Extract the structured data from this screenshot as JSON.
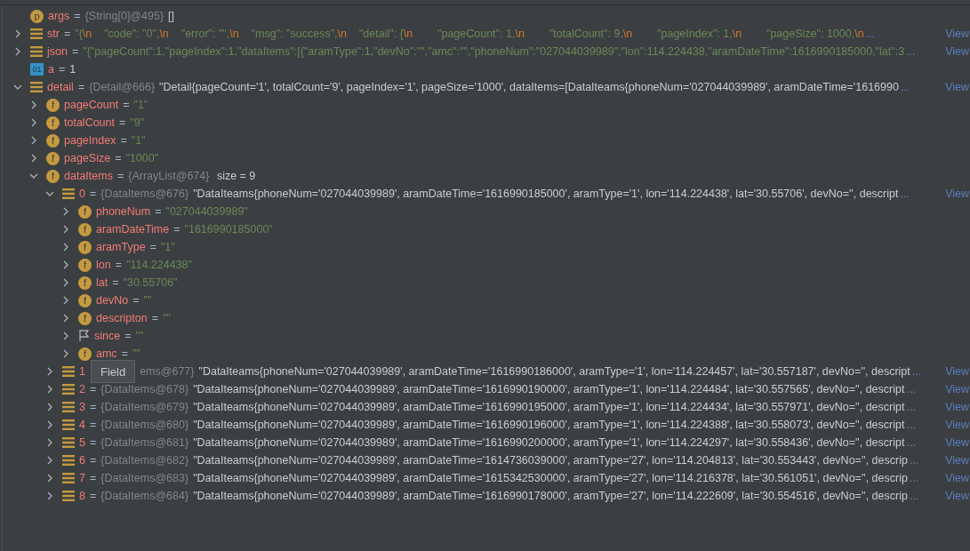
{
  "variables": [
    {
      "icon": {
        "kind": "circle",
        "glyph": "p"
      },
      "name": "args",
      "eq": "=",
      "type": "{String[0]@495}",
      "value": [
        {
          "kind": "plain",
          "text": "[]"
        }
      ]
    },
    {
      "icon": {
        "kind": "list"
      },
      "name": "str",
      "eq": "=",
      "expanded": false,
      "value": [
        {
          "kind": "str",
          "text": "\"{"
        },
        {
          "kind": "esc",
          "text": "\\n"
        },
        {
          "kind": "str",
          "text": "    \"code\": \"0\","
        },
        {
          "kind": "esc",
          "text": "\\n"
        },
        {
          "kind": "str",
          "text": "    \"error\": \"\","
        },
        {
          "kind": "esc",
          "text": "\\n"
        },
        {
          "kind": "str",
          "text": "    \"msg\": \"success\","
        },
        {
          "kind": "esc",
          "text": "\\n"
        },
        {
          "kind": "str",
          "text": "    \"detail\": {"
        },
        {
          "kind": "esc",
          "text": "\\n"
        },
        {
          "kind": "str",
          "text": "        \"pageCount\": 1,"
        },
        {
          "kind": "esc",
          "text": "\\n"
        },
        {
          "kind": "str",
          "text": "        \"totalCount\": 9,"
        },
        {
          "kind": "esc",
          "text": "\\n"
        },
        {
          "kind": "str",
          "text": "        \"pageIndex\": 1,"
        },
        {
          "kind": "esc",
          "text": "\\n"
        },
        {
          "kind": "str",
          "text": "        \"pageSize\": 1000,"
        },
        {
          "kind": "esc",
          "text": "\\n"
        }
      ],
      "tail": "...",
      "link": "View"
    },
    {
      "icon": {
        "kind": "list"
      },
      "name": "json",
      "eq": "=",
      "expanded": false,
      "value": [
        {
          "kind": "str",
          "text": "\"{\"pageCount\":1,\"pageIndex\":1,\"dataItems\":[{\"aramType\":1,\"devNo\":\"\",\"amc\":\"\",\"phoneNum\":\"027044039989\",\"lon\":114.224438,\"aramDateTime\":1616990185000,\"lat\":3"
        }
      ],
      "tail": "...",
      "link": "View"
    },
    {
      "icon": {
        "kind": "square",
        "glyph": "01"
      },
      "name": "a",
      "eq": "=",
      "value": [
        {
          "kind": "plain",
          "text": "1"
        }
      ]
    },
    {
      "icon": {
        "kind": "list"
      },
      "name": "detail",
      "eq": "=",
      "expanded": true,
      "type": "{Detail@666}",
      "value": [
        {
          "kind": "plain",
          "text": "\"Detail{pageCount='1', totalCount='9', pageIndex='1', pageSize='1000', dataItems=[DataIteams{phoneNum='027044039989', aramDateTime='1616990"
        }
      ],
      "tail": "...",
      "link": "View",
      "children": [
        {
          "icon": {
            "kind": "circle",
            "glyph": "f"
          },
          "name": "pageCount",
          "eq": "=",
          "expanded": false,
          "value": [
            {
              "kind": "str",
              "text": "\"1\""
            }
          ]
        },
        {
          "icon": {
            "kind": "circle",
            "glyph": "f"
          },
          "name": "totalCount",
          "eq": "=",
          "expanded": false,
          "value": [
            {
              "kind": "str",
              "text": "\"9\""
            }
          ]
        },
        {
          "icon": {
            "kind": "circle",
            "glyph": "f"
          },
          "name": "pageIndex",
          "eq": "=",
          "expanded": false,
          "value": [
            {
              "kind": "str",
              "text": "\"1\""
            }
          ]
        },
        {
          "icon": {
            "kind": "circle",
            "glyph": "f"
          },
          "name": "pageSize",
          "eq": "=",
          "expanded": false,
          "value": [
            {
              "kind": "str",
              "text": "\"1000\""
            }
          ]
        },
        {
          "icon": {
            "kind": "circle",
            "glyph": "f"
          },
          "name": "dataItems",
          "eq": "=",
          "expanded": true,
          "type": "{ArrayList@674}",
          "value": [
            {
              "kind": "plain",
              "text": " size = 9"
            }
          ],
          "children": [
            {
              "icon": {
                "kind": "list"
              },
              "name": "0",
              "eq": "=",
              "expanded": true,
              "type": "{DataItems@676}",
              "value": [
                {
                  "kind": "plain",
                  "text": "\"DataIteams{phoneNum='027044039989', aramDateTime='1616990185000', aramType='1', lon='114.224438', lat='30.55706', devNo='', descript"
                }
              ],
              "tail": "...",
              "link": "View",
              "children": [
                {
                  "icon": {
                    "kind": "circle",
                    "glyph": "f"
                  },
                  "name": "phoneNum",
                  "eq": "=",
                  "expanded": false,
                  "value": [
                    {
                      "kind": "str",
                      "text": "\"027044039989\""
                    }
                  ]
                },
                {
                  "icon": {
                    "kind": "circle",
                    "glyph": "f"
                  },
                  "name": "aramDateTime",
                  "eq": "=",
                  "expanded": false,
                  "value": [
                    {
                      "kind": "str",
                      "text": "\"1616990185000\""
                    }
                  ]
                },
                {
                  "icon": {
                    "kind": "circle",
                    "glyph": "f"
                  },
                  "name": "aramType",
                  "eq": "=",
                  "expanded": false,
                  "value": [
                    {
                      "kind": "str",
                      "text": "\"1\""
                    }
                  ]
                },
                {
                  "icon": {
                    "kind": "circle",
                    "glyph": "f"
                  },
                  "name": "lon",
                  "eq": "=",
                  "expanded": false,
                  "value": [
                    {
                      "kind": "str",
                      "text": "\"114.224438\""
                    }
                  ]
                },
                {
                  "icon": {
                    "kind": "circle",
                    "glyph": "f"
                  },
                  "name": "lat",
                  "eq": "=",
                  "expanded": false,
                  "value": [
                    {
                      "kind": "str",
                      "text": "\"30.55706\""
                    }
                  ]
                },
                {
                  "icon": {
                    "kind": "circle",
                    "glyph": "f"
                  },
                  "name": "devNo",
                  "eq": "=",
                  "expanded": false,
                  "value": [
                    {
                      "kind": "str",
                      "text": "\"\""
                    }
                  ]
                },
                {
                  "icon": {
                    "kind": "circle",
                    "glyph": "f"
                  },
                  "name": "descripton",
                  "eq": "=",
                  "expanded": false,
                  "value": [
                    {
                      "kind": "str",
                      "text": "\"\""
                    }
                  ]
                },
                {
                  "icon": {
                    "kind": "flag"
                  },
                  "name": "since",
                  "eq": "=",
                  "expanded": false,
                  "value": [
                    {
                      "kind": "str",
                      "text": "\"\""
                    }
                  ]
                },
                {
                  "icon": {
                    "kind": "circle",
                    "glyph": "f"
                  },
                  "name": "amc",
                  "eq": "=",
                  "expanded": false,
                  "value": [
                    {
                      "kind": "str",
                      "text": "\"\""
                    }
                  ]
                }
              ]
            },
            {
              "icon": {
                "kind": "list"
              },
              "name": "1",
              "tooltip": "Field",
              "expanded": false,
              "type": "ems@677}",
              "value": [
                {
                  "kind": "plain",
                  "text": "\"DataIteams{phoneNum='027044039989', aramDateTime='1616990186000', aramType='1', lon='114.224457', lat='30.557187', devNo='', descript"
                }
              ],
              "tail": "...",
              "link": "View"
            },
            {
              "icon": {
                "kind": "list"
              },
              "name": "2",
              "eq": "=",
              "expanded": false,
              "type": "{DataItems@678}",
              "value": [
                {
                  "kind": "plain",
                  "text": "\"DataIteams{phoneNum='027044039989', aramDateTime='1616990190000', aramType='1', lon='114.224484', lat='30.557565', devNo='', descript"
                }
              ],
              "tail": "...",
              "link": "View"
            },
            {
              "icon": {
                "kind": "list"
              },
              "name": "3",
              "eq": "=",
              "expanded": false,
              "type": "{DataItems@679}",
              "value": [
                {
                  "kind": "plain",
                  "text": "\"DataIteams{phoneNum='027044039989', aramDateTime='1616990195000', aramType='1', lon='114.224434', lat='30.557971', devNo='', descript"
                }
              ],
              "tail": "...",
              "link": "View"
            },
            {
              "icon": {
                "kind": "list"
              },
              "name": "4",
              "eq": "=",
              "expanded": false,
              "type": "{DataItems@680}",
              "value": [
                {
                  "kind": "plain",
                  "text": "\"DataIteams{phoneNum='027044039989', aramDateTime='1616990196000', aramType='1', lon='114.224388', lat='30.558073', devNo='', descript"
                }
              ],
              "tail": "...",
              "link": "View"
            },
            {
              "icon": {
                "kind": "list"
              },
              "name": "5",
              "eq": "=",
              "expanded": false,
              "type": "{DataItems@681}",
              "value": [
                {
                  "kind": "plain",
                  "text": "\"DataIteams{phoneNum='027044039989', aramDateTime='1616990200000', aramType='1', lon='114.224297', lat='30.558436', devNo='', descript"
                }
              ],
              "tail": "...",
              "link": "View"
            },
            {
              "icon": {
                "kind": "list"
              },
              "name": "6",
              "eq": "=",
              "expanded": false,
              "type": "{DataItems@682}",
              "value": [
                {
                  "kind": "plain",
                  "text": "\"DataIteams{phoneNum='027044039989', aramDateTime='1614736039000', aramType='27', lon='114.204813', lat='30.553443', devNo='', descrip"
                }
              ],
              "tail": "...",
              "link": "View"
            },
            {
              "icon": {
                "kind": "list"
              },
              "name": "7",
              "eq": "=",
              "expanded": false,
              "type": "{DataItems@683}",
              "value": [
                {
                  "kind": "plain",
                  "text": "\"DataIteams{phoneNum='027044039989', aramDateTime='1615342530000', aramType='27', lon='114.216378', lat='30.561051', devNo='', descrip"
                }
              ],
              "tail": "...",
              "link": "View"
            },
            {
              "icon": {
                "kind": "list"
              },
              "name": "8",
              "eq": "=",
              "expanded": false,
              "type": "{DataItems@684}",
              "value": [
                {
                  "kind": "plain",
                  "text": "\"DataIteams{phoneNum='027044039989', aramDateTime='1616990178000', aramType='27', lon='114.222609', lat='30.554516', devNo='', descrip"
                }
              ],
              "tail": "...",
              "link": "View"
            }
          ]
        }
      ]
    }
  ]
}
